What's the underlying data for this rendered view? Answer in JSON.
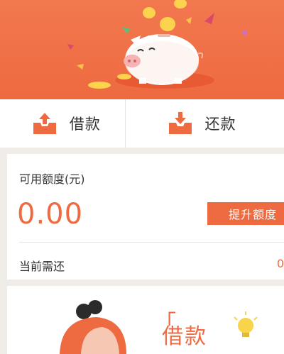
{
  "banner": {
    "illustration": "piggy-bank-with-coins"
  },
  "actions": {
    "borrow_label": "借款",
    "repay_label": "还款"
  },
  "credit": {
    "available_label": "可用额度(元)",
    "available_amount": "0.00",
    "raise_button_label": "提升额度",
    "due_label": "当前需还",
    "due_value": "0"
  },
  "promo": {
    "title": "借款",
    "open_quote": "「"
  },
  "colors": {
    "accent": "#ee6a40",
    "background": "#f0ede9"
  }
}
